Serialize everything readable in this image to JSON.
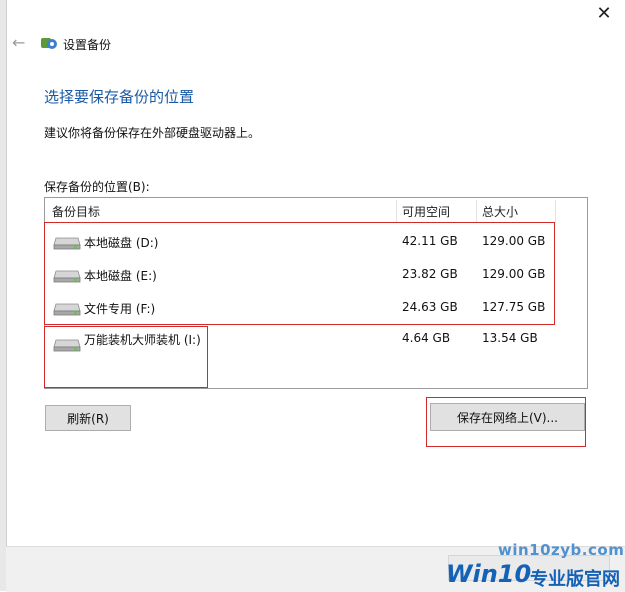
{
  "window": {
    "title": "设置备份",
    "close_glyph": "✕",
    "back_glyph": "←"
  },
  "page": {
    "title": "选择要保存备份的位置",
    "subtitle": "建议你将备份保存在外部硬盘驱动器上。",
    "list_label": "保存备份的位置(B):"
  },
  "table": {
    "columns": [
      "备份目标",
      "可用空间",
      "总大小"
    ],
    "rows": [
      {
        "name": "本地磁盘 (D:)",
        "free": "42.11 GB",
        "total": "129.00 GB",
        "icon": "drive-icon"
      },
      {
        "name": "本地磁盘 (E:)",
        "free": "23.82 GB",
        "total": "129.00 GB",
        "icon": "drive-icon"
      },
      {
        "name": "文件专用 (F:)",
        "free": "24.63 GB",
        "total": "127.75 GB",
        "icon": "drive-icon"
      },
      {
        "name": "万能装机大师装机 (I:)",
        "free": "4.64 GB",
        "total": "13.54 GB",
        "icon": "drive-icon"
      }
    ]
  },
  "buttons": {
    "refresh": "刷新(R)",
    "save_network": "保存在网络上(V)..."
  },
  "watermark": {
    "site": "win10zyb.com",
    "logo": "Win10",
    "text": "专业版官网"
  },
  "colors": {
    "title_blue": "#1a5aa6",
    "highlight_red": "#d22a2a",
    "watermark_blue": "#1462b8"
  }
}
